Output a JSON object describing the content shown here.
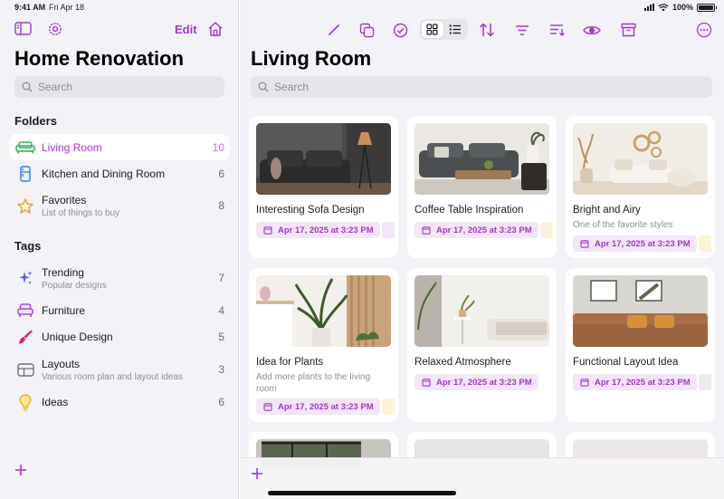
{
  "status": {
    "time": "9:41 AM",
    "date": "Fri Apr 18",
    "battery": "100%",
    "battery_level": 1.0
  },
  "sidebar": {
    "edit_label": "Edit",
    "title": "Home Renovation",
    "search_placeholder": "Search",
    "folders_title": "Folders",
    "folders": [
      {
        "label": "Living Room",
        "count": "10",
        "icon": "sofa-icon",
        "active": true
      },
      {
        "label": "Kitchen and Dining Room",
        "count": "6",
        "icon": "fridge-icon"
      },
      {
        "label": "Favorites",
        "subtitle": "List of things to buy",
        "count": "8",
        "icon": "star-icon"
      }
    ],
    "tags_title": "Tags",
    "tags": [
      {
        "label": "Trending",
        "subtitle": "Popular designs",
        "count": "7",
        "icon": "sparkles-icon"
      },
      {
        "label": "Furniture",
        "count": "4",
        "icon": "armchair-icon"
      },
      {
        "label": "Unique Design",
        "count": "5",
        "icon": "paintbrush-icon"
      },
      {
        "label": "Layouts",
        "subtitle": "Various room plan and layout ideas",
        "count": "3",
        "icon": "layout-grid-icon"
      },
      {
        "label": "Ideas",
        "count": "6",
        "icon": "lightbulb-icon"
      }
    ]
  },
  "main": {
    "title": "Living Room",
    "search_placeholder": "Search",
    "cards": [
      {
        "title": "Interesting Sofa Design",
        "subtitle": "",
        "date": "Apr 17, 2025 at 3:23 PM",
        "tag_color": "#f2e6f7"
      },
      {
        "title": "Coffee Table Inspiration",
        "subtitle": "",
        "date": "Apr 17, 2025 at 3:23 PM",
        "tag_color": "#f7f4d9"
      },
      {
        "title": "Bright and Airy",
        "subtitle": "One of the favorite styles",
        "date": "Apr 17, 2025 at 3:23 PM",
        "tag_color": "#fbf4d4"
      },
      {
        "title": "Idea for Plants",
        "subtitle": "Add more plants to the living room",
        "date": "Apr 17, 2025 at 3:23 PM",
        "tag_color": "#fbf4d4"
      },
      {
        "title": "Relaxed Atmosphere",
        "subtitle": "",
        "date": "Apr 17, 2025 at 3:23 PM",
        "tag_color": ""
      },
      {
        "title": "Functional Layout Idea",
        "subtitle": "",
        "date": "Apr 17, 2025 at 3:23 PM",
        "tag_color": "#ececef"
      }
    ]
  },
  "colors": {
    "accent": "#a437c9",
    "chip_bg": "#f2e6f7"
  }
}
